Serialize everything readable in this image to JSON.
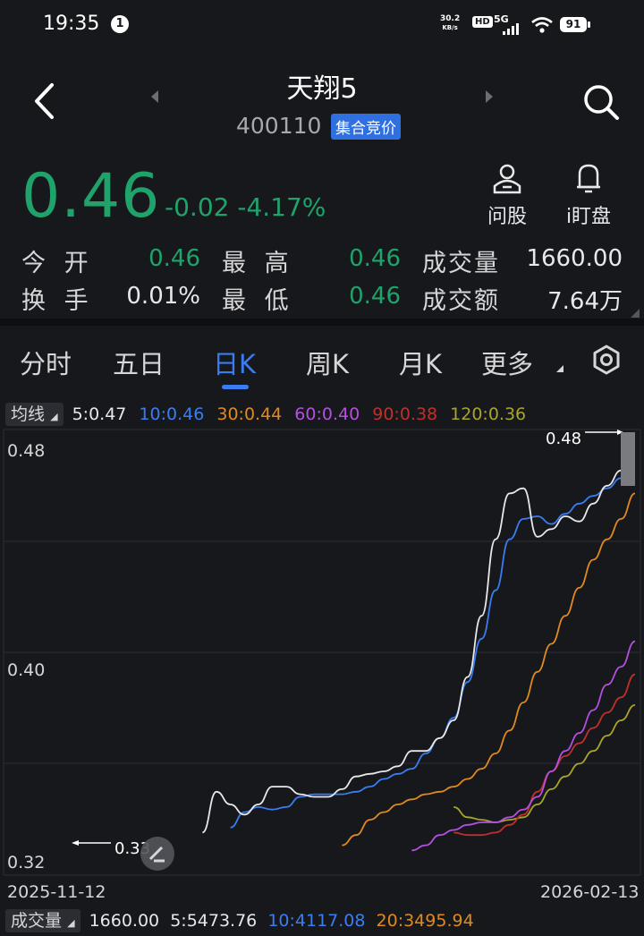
{
  "status": {
    "time": "19:35",
    "notif_count": "1",
    "net_speed_value": "30.2",
    "net_speed_unit": "KB/s",
    "hd": "HD",
    "network": "5G",
    "battery": "91"
  },
  "header": {
    "title": "天翔5",
    "code": "400110",
    "badge": "集合竞价"
  },
  "quote": {
    "price": "0.46",
    "change": "-0.02",
    "change_pct": "-4.17%",
    "price_color": "#1fa36b"
  },
  "quick_actions": [
    {
      "label": "问股",
      "icon": "person-icon"
    },
    {
      "label": "i盯盘",
      "icon": "bell-icon"
    }
  ],
  "stats": {
    "open_label": "今 开",
    "open": "0.46",
    "high_label": "最 高",
    "high": "0.46",
    "volume_label": "成交量",
    "volume": "1660.00",
    "turnover_label": "换 手",
    "turnover": "0.01%",
    "low_label": "最 低",
    "low": "0.46",
    "amount_label": "成交额",
    "amount": "7.64万"
  },
  "tabs": [
    {
      "label": "分时"
    },
    {
      "label": "五日"
    },
    {
      "label": "日K",
      "active": true
    },
    {
      "label": "周K"
    },
    {
      "label": "月K"
    },
    {
      "label": "更多"
    }
  ],
  "ma_bar": {
    "selector": "均线",
    "items": [
      {
        "text": "5:0.47",
        "color": "#e8e8ea"
      },
      {
        "text": "10:0.46",
        "color": "#3a7df0"
      },
      {
        "text": "30:0.44",
        "color": "#e08a1e"
      },
      {
        "text": "60:0.40",
        "color": "#b44fe0"
      },
      {
        "text": "90:0.38",
        "color": "#c0302a"
      },
      {
        "text": "120:0.36",
        "color": "#a9a52a"
      }
    ]
  },
  "chart_data": {
    "type": "line",
    "y_axis_labels": [
      "0.48",
      "0.40",
      "0.32"
    ],
    "ylim": [
      0.318,
      0.484
    ],
    "x_start_label": "2025-11-12",
    "x_end_label": "2026-02-13",
    "max_marker": "0.48",
    "min_marker": "0.33",
    "n": 46,
    "ma5": [
      0.327,
      0.343,
      0.338,
      0.334,
      0.338,
      0.345,
      0.345,
      0.342,
      0.341,
      0.341,
      0.344,
      0.349,
      0.35,
      0.351,
      0.353,
      0.359,
      0.359,
      0.364,
      0.371,
      0.388,
      0.412,
      0.442,
      0.46,
      0.462,
      0.443,
      0.446,
      0.451,
      0.449,
      0.456,
      0.463,
      0.469,
      0.478
    ],
    "ma10": [
      0.329,
      0.335,
      0.337,
      0.336,
      0.337,
      0.341,
      0.342,
      0.342,
      0.342,
      0.343,
      0.345,
      0.348,
      0.35,
      0.352,
      0.358,
      0.364,
      0.372,
      0.386,
      0.403,
      0.422,
      0.442,
      0.45,
      0.451,
      0.448,
      0.452,
      0.456,
      0.459,
      0.462,
      0.466,
      0.469
    ],
    "ma30": [
      0.322,
      0.326,
      0.332,
      0.335,
      0.338,
      0.34,
      0.342,
      0.343,
      0.345,
      0.348,
      0.352,
      0.358,
      0.367,
      0.378,
      0.39,
      0.401,
      0.412,
      0.423,
      0.434,
      0.442,
      0.45,
      0.46
    ],
    "ma60": [
      0.32,
      0.322,
      0.326,
      0.328,
      0.33,
      0.331,
      0.331,
      0.333,
      0.336,
      0.341,
      0.351,
      0.359,
      0.366,
      0.375,
      0.385,
      0.392,
      0.402
    ],
    "ma90": [
      0.327,
      0.326,
      0.326,
      0.327,
      0.33,
      0.334,
      0.343,
      0.351,
      0.357,
      0.362,
      0.368,
      0.374,
      0.38,
      0.389
    ],
    "ma120": [
      0.337,
      0.333,
      0.332,
      0.331,
      0.332,
      0.333,
      0.338,
      0.344,
      0.349,
      0.354,
      0.359,
      0.365,
      0.371,
      0.377
    ]
  },
  "volume_bar": {
    "selector": "成交量",
    "value": "1660.00",
    "ma5": "5:5473.76",
    "ma10": "10:4117.08",
    "ma20": "20:3495.94"
  }
}
